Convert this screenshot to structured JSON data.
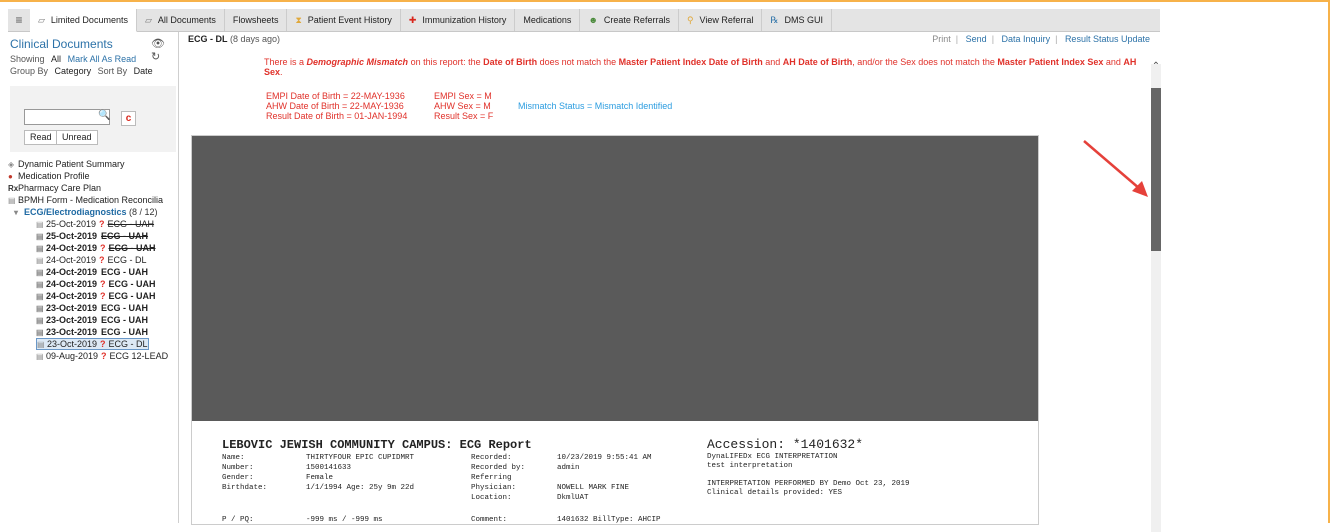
{
  "tabs": [
    {
      "label": "Limited Documents",
      "icon": "document-icon"
    },
    {
      "label": "All Documents",
      "icon": "document-icon"
    },
    {
      "label": "Flowsheets",
      "icon": ""
    },
    {
      "label": "Patient Event History",
      "icon": "hourglass-icon"
    },
    {
      "label": "Immunization History",
      "icon": "syringe-icon"
    },
    {
      "label": "Medications",
      "icon": ""
    },
    {
      "label": "Create Referrals",
      "icon": "people-icon"
    },
    {
      "label": "View Referral",
      "icon": "magnifier-icon"
    },
    {
      "label": "DMS GUI",
      "icon": "rx-icon"
    }
  ],
  "left": {
    "title": "Clinical Documents",
    "showing_label": "Showing",
    "showing_value": "All",
    "mark_all_read": "Mark All As Read",
    "group_by_label": "Group By",
    "group_by_value": "Category",
    "sort_by_label": "Sort By",
    "sort_by_value": "Date",
    "clear_label": "c",
    "read_label": "Read",
    "unread_label": "Unread",
    "items": [
      {
        "label": "Dynamic Patient Summary"
      },
      {
        "label": "Medication Profile"
      },
      {
        "label": "Pharmacy Care Plan",
        "prefix": "Rx"
      },
      {
        "label": "BPMH Form - Medication Reconcilia"
      }
    ],
    "folder": {
      "label": "ECG/Electrodiagnostics",
      "count": "(8 / 12)"
    },
    "docs": [
      {
        "date": "25-Oct-2019",
        "q": "?",
        "name": "ECG - UAH",
        "bold": false,
        "strike": true
      },
      {
        "date": "25-Oct-2019",
        "q": "",
        "name": "ECG - UAH",
        "bold": true,
        "strike": true
      },
      {
        "date": "24-Oct-2019",
        "q": "?",
        "name": "ECG - UAH",
        "bold": true,
        "strike": true
      },
      {
        "date": "24-Oct-2019",
        "q": "?",
        "name": "ECG - DL",
        "bold": false,
        "strike": false
      },
      {
        "date": "24-Oct-2019",
        "q": "",
        "name": "ECG - UAH",
        "bold": true,
        "strike": false
      },
      {
        "date": "24-Oct-2019",
        "q": "?",
        "name": "ECG - UAH",
        "bold": true,
        "strike": false
      },
      {
        "date": "24-Oct-2019",
        "q": "?",
        "name": "ECG - UAH",
        "bold": true,
        "strike": false
      },
      {
        "date": "23-Oct-2019",
        "q": "",
        "name": "ECG - UAH",
        "bold": true,
        "strike": false
      },
      {
        "date": "23-Oct-2019",
        "q": "",
        "name": "ECG - UAH",
        "bold": true,
        "strike": false
      },
      {
        "date": "23-Oct-2019",
        "q": "",
        "name": "ECG - UAH",
        "bold": true,
        "strike": false
      },
      {
        "date": "23-Oct-2019",
        "q": "?",
        "name": "ECG - DL",
        "bold": false,
        "strike": false,
        "selected": true
      },
      {
        "date": "09-Aug-2019",
        "q": "?",
        "name": "ECG 12-LEAD",
        "bold": false,
        "strike": false
      }
    ]
  },
  "right": {
    "doc_title": "ECG - DL",
    "doc_age": "(8 days ago)",
    "actions": [
      "Print",
      "Send",
      "Data Inquiry",
      "Result Status Update"
    ],
    "mismatch": {
      "p1": "There is a ",
      "p2": "Demographic Mismatch",
      "p3": " on this report: the ",
      "p4": "Date of Birth",
      "p5": " does not match the ",
      "p6": "Master Patient Index Date of Birth",
      "p7": " and ",
      "p8": "AH Date of Birth",
      "p9": ", and/or the Sex does not match the ",
      "p10": "Master Patient Index Sex",
      "p11": " and ",
      "p12": "AH Sex",
      "p13": "."
    },
    "mismatch_rows": [
      {
        "dob": "EMPI Date of Birth = 22-MAY-1936",
        "sex": "EMPI Sex = M",
        "status": ""
      },
      {
        "dob": "AHW Date of Birth = 22-MAY-1936",
        "sex": "AHW Sex = M",
        "status": "Mismatch Status = Mismatch Identified"
      },
      {
        "dob": "Result Date of Birth = 01-JAN-1994",
        "sex": "Result Sex = F",
        "status": ""
      }
    ],
    "report": {
      "title": "LEBOVIC JEWISH COMMUNITY CAMPUS: ECG Report",
      "accession": "Accession: *1401632*",
      "acc_lines": [
        "DynaLIFEDx ECG INTERPRETATION",
        "test interpretation",
        "",
        "INTERPRETATION PERFORMED BY Demo Oct 23, 2019",
        "Clinical details provided: YES"
      ],
      "rows": [
        [
          "Name:",
          "THIRTYFOUR EPIC CUPIDMRT",
          "Recorded:",
          "10/23/2019 9:55:41 AM"
        ],
        [
          "Number:",
          "1500141633",
          "Recorded by:",
          "admin"
        ],
        [
          "Gender:",
          "Female",
          "Referring",
          ""
        ],
        [
          "Birthdate:",
          "1/1/1994   Age: 25y 9m 22d",
          "Physician:",
          "NOWELL MARK FINE"
        ],
        [
          "",
          "",
          "Location:",
          "DkmlUAT"
        ],
        [
          "P / PQ:",
          "-999 ms / -999 ms",
          "Comment:",
          "1401632 BillType: AHCIP"
        ]
      ]
    }
  }
}
